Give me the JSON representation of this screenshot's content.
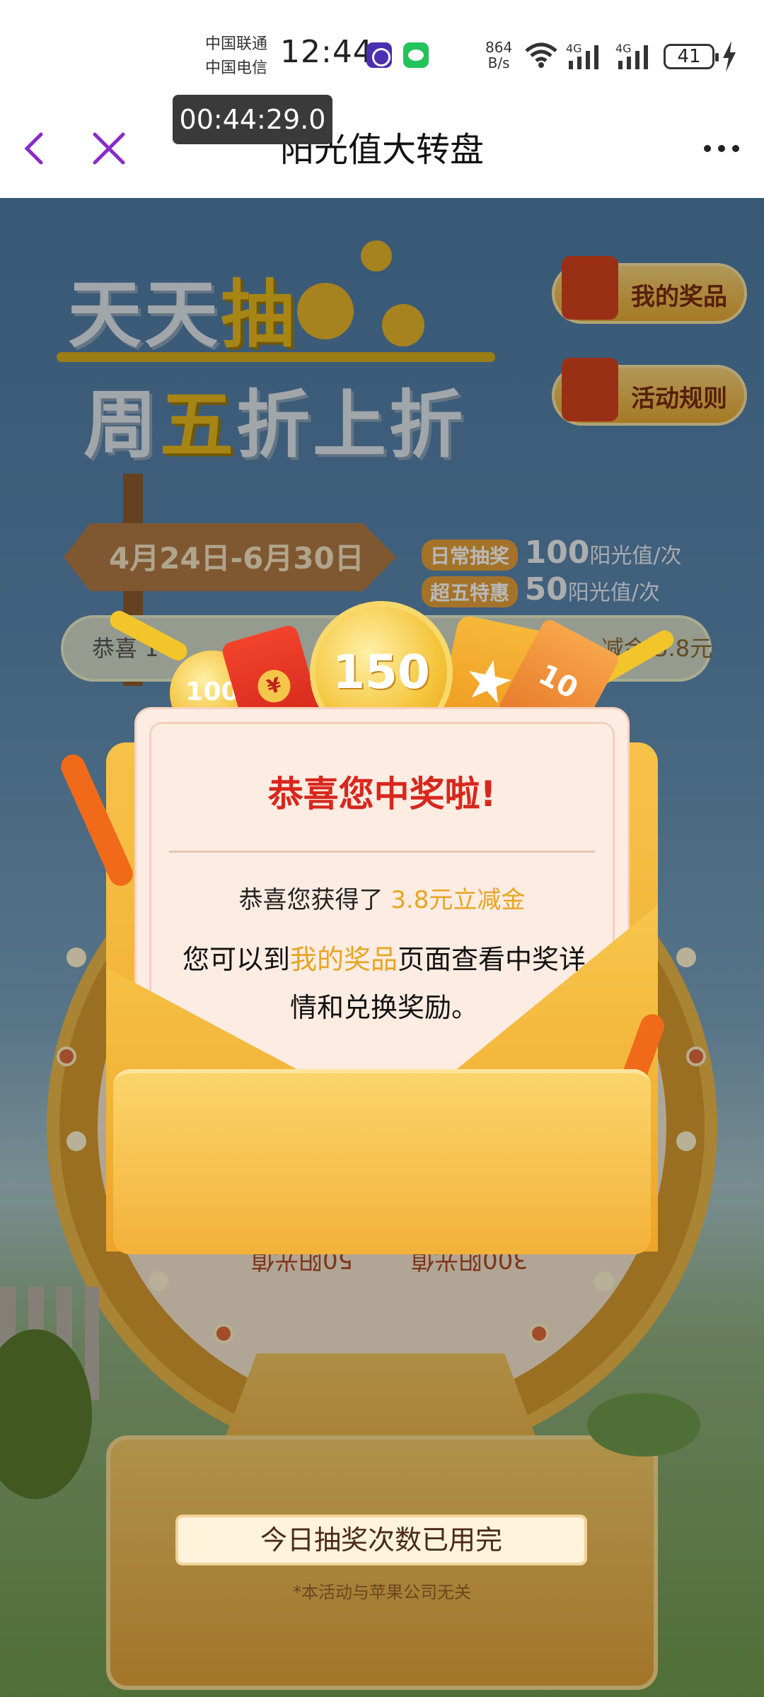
{
  "status_bar": {
    "carrier1": "中国联通",
    "carrier2": "中国电信",
    "time": "12:44",
    "net_speed_value": "864",
    "net_speed_unit": "B/s",
    "signal1": "4G",
    "signal2": "4G",
    "battery": "41"
  },
  "timer_badge": "00:44:29.0",
  "nav": {
    "title": "阳光值大转盘"
  },
  "hero": {
    "line1_a": "天天",
    "line1_b": "抽",
    "line2_a": "周",
    "line2_b": "五",
    "line2_c": "折上折"
  },
  "side_buttons": {
    "prizes": "我的奖品",
    "rules": "活动规则"
  },
  "date_range": "4月24日-6月30日",
  "pricing": {
    "daily_tag": "日常抽奖",
    "daily_num": "100",
    "daily_unit": "阳光值/次",
    "super_tag": "超五特惠",
    "super_num": "50",
    "super_unit": "阳光值/次"
  },
  "marquee": {
    "left": "恭喜 1",
    "right": "减金 3.8元"
  },
  "wheel": {
    "seg1": "50阳光值",
    "seg2": "300阳光值"
  },
  "prizes_art": {
    "coin_big": "150",
    "coin_small": "100",
    "ticket": "10"
  },
  "popup": {
    "title": "恭喜您中奖啦!",
    "line1_prefix": "恭喜您获得了",
    "line1_amount": "3.8元立减金",
    "line2_prefix": "您可以到",
    "line2_link": "我的奖品",
    "line2_suffix": "页面查看中奖详情和兑换奖励。"
  },
  "bottom": {
    "used_up": "今日抽奖次数已用完",
    "disclaimer": "*本活动与苹果公司无关"
  },
  "colors": {
    "accent_red": "#d8271e",
    "accent_gold": "#e7a521",
    "nav_purple": "#8a2bc8"
  }
}
